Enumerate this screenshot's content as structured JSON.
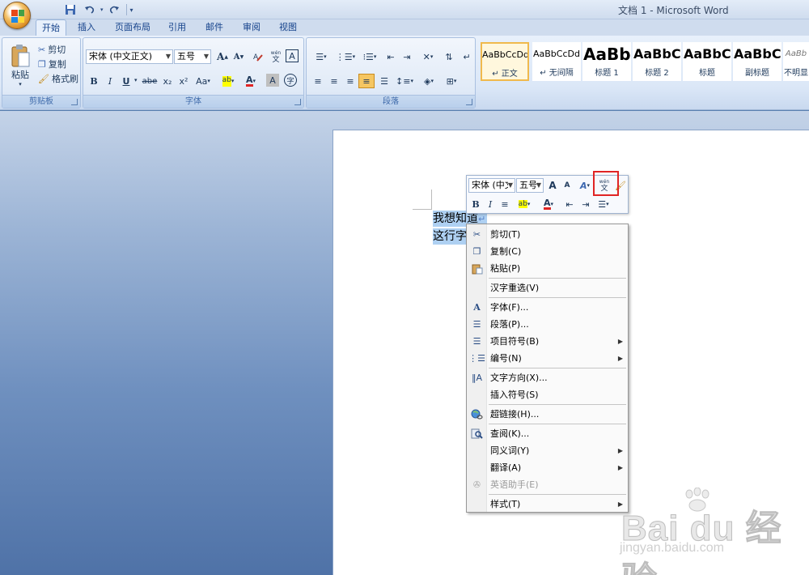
{
  "window": {
    "title": "文档 1 - Microsoft Word"
  },
  "qat": {
    "icons": [
      "save-icon",
      "undo-icon",
      "redo-icon",
      "customize-dropdown-icon"
    ]
  },
  "tabs": [
    {
      "label": "开始",
      "active": true
    },
    {
      "label": "插入"
    },
    {
      "label": "页面布局"
    },
    {
      "label": "引用"
    },
    {
      "label": "邮件"
    },
    {
      "label": "审阅"
    },
    {
      "label": "视图"
    }
  ],
  "clipboard": {
    "group_label": "剪贴板",
    "paste_label": "粘贴",
    "cut_label": "剪切",
    "copy_label": "复制",
    "format_painter_label": "格式刷"
  },
  "font": {
    "group_label": "字体",
    "font_name": "宋体 (中文正文)",
    "font_size": "五号",
    "grow_label": "A",
    "shrink_label": "A",
    "phonetic_label": "wén",
    "char_border_label": "A",
    "bold": "B",
    "italic": "I",
    "underline": "U",
    "strike": "abe",
    "subscript": "x₂",
    "superscript": "x²",
    "change_case": "Aa",
    "highlight_label": "ab",
    "font_color_label": "A",
    "char_shading_label": "A",
    "enclose_label": "字"
  },
  "paragraph": {
    "group_label": "段落"
  },
  "styles": {
    "items": [
      {
        "sample": "AaBbCcDd",
        "name": "↵ 正文",
        "selected": true
      },
      {
        "sample": "AaBbCcDd",
        "name": "↵ 无间隔"
      },
      {
        "sample": "AaBb",
        "name": "标题 1"
      },
      {
        "sample": "AaBbC",
        "name": "标题 2"
      },
      {
        "sample": "AaBbC",
        "name": "标题"
      },
      {
        "sample": "AaBbC",
        "name": "副标题"
      },
      {
        "sample": "AaBb",
        "name": "不明显"
      }
    ]
  },
  "document": {
    "lines": [
      "我想知道",
      "这行字"
    ],
    "paragraph_mark": "↵"
  },
  "mini_toolbar": {
    "font_name": "宋体 (中文",
    "font_size": "五号",
    "grow_label": "A",
    "shrink_label": "A",
    "style_label": "A",
    "phonetic_label": "wén",
    "bold": "B",
    "italic": "I",
    "highlight_label": "ab",
    "font_color_label": "A"
  },
  "context_menu": {
    "items": [
      {
        "label": "剪切(T)",
        "icon": "scissors-icon"
      },
      {
        "label": "复制(C)",
        "icon": "copy-icon"
      },
      {
        "label": "粘贴(P)",
        "icon": "paste-icon"
      },
      {
        "label": "汉字重选(V)"
      },
      {
        "label": "字体(F)...",
        "icon": "font-icon"
      },
      {
        "label": "段落(P)...",
        "icon": "paragraph-icon"
      },
      {
        "label": "项目符号(B)",
        "icon": "bullets-icon",
        "submenu": true
      },
      {
        "label": "编号(N)",
        "icon": "numbering-icon",
        "submenu": true
      },
      {
        "label": "文字方向(X)...",
        "icon": "text-direction-icon"
      },
      {
        "label": "插入符号(S)"
      },
      {
        "label": "超链接(H)...",
        "icon": "hyperlink-icon"
      },
      {
        "label": "查阅(K)...",
        "icon": "lookup-icon"
      },
      {
        "label": "同义词(Y)",
        "submenu": true
      },
      {
        "label": "翻译(A)",
        "submenu": true
      },
      {
        "label": "英语助手(E)",
        "icon": "english-assistant-icon",
        "disabled": true
      },
      {
        "label": "样式(T)",
        "submenu": true
      }
    ]
  },
  "watermark": {
    "brand": "Bai du 经验",
    "url": "jingyan.baidu.com"
  },
  "colors": {
    "highlight_box": "#e02424",
    "selection": "#aed0f2",
    "ribbon_bg": "#dbe7f7"
  }
}
